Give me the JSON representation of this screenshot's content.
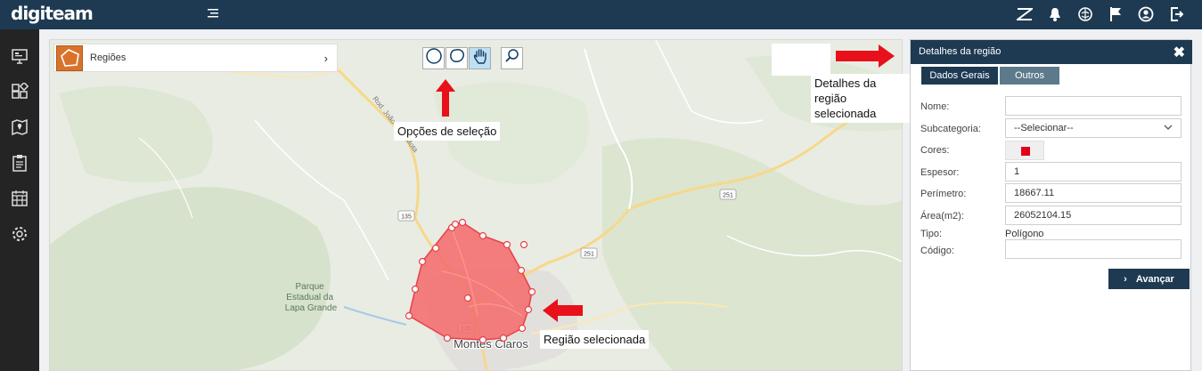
{
  "app": {
    "logo_text": "digiteam"
  },
  "topbar": {
    "icons": [
      "zendesk-icon",
      "bell-icon",
      "brain-icon",
      "flag-icon",
      "user-icon",
      "logout-icon"
    ]
  },
  "sidebar": {
    "items": [
      {
        "icon": "presentation-icon"
      },
      {
        "icon": "blocks-icon"
      },
      {
        "icon": "map-icon"
      },
      {
        "icon": "clipboard-icon"
      },
      {
        "icon": "calendar-icon"
      },
      {
        "icon": "gear-icon"
      }
    ]
  },
  "map": {
    "regions_label": "Regiões",
    "labels": {
      "road": "Rod. João Pinto Mota",
      "park": "Parque Estadual da Lapa Grande",
      "city": "Montes Claros",
      "shield_135_a": "135",
      "shield_135_b": "135",
      "shield_251_a": "251",
      "shield_251_b": "251"
    },
    "annotations": {
      "selection_options": "Opções de seleção",
      "region_details": "Detalhes da região selecionada",
      "selected_region": "Região selecionada"
    },
    "polygon_color": "#f26d6d"
  },
  "panel": {
    "title": "Detalhes da região",
    "close": "✖",
    "tabs": [
      "Dados Gerais",
      "Outros"
    ],
    "form": {
      "nome_label": "Nome:",
      "nome_value": "",
      "subcategoria_label": "Subcategoria:",
      "subcategoria_value": "--Selecionar--",
      "cores_label": "Cores:",
      "cores_value": "#e0001a",
      "espesor_label": "Espesor:",
      "espesor_value": "1",
      "perimetro_label": "Perímetro:",
      "perimetro_value": "18667.11",
      "area_label": "Área(m2):",
      "area_value": "26052104.15",
      "tipo_label": "Tipo:",
      "tipo_value": "Polígono",
      "codigo_label": "Código:",
      "codigo_value": ""
    },
    "next_button": "Avançar"
  }
}
